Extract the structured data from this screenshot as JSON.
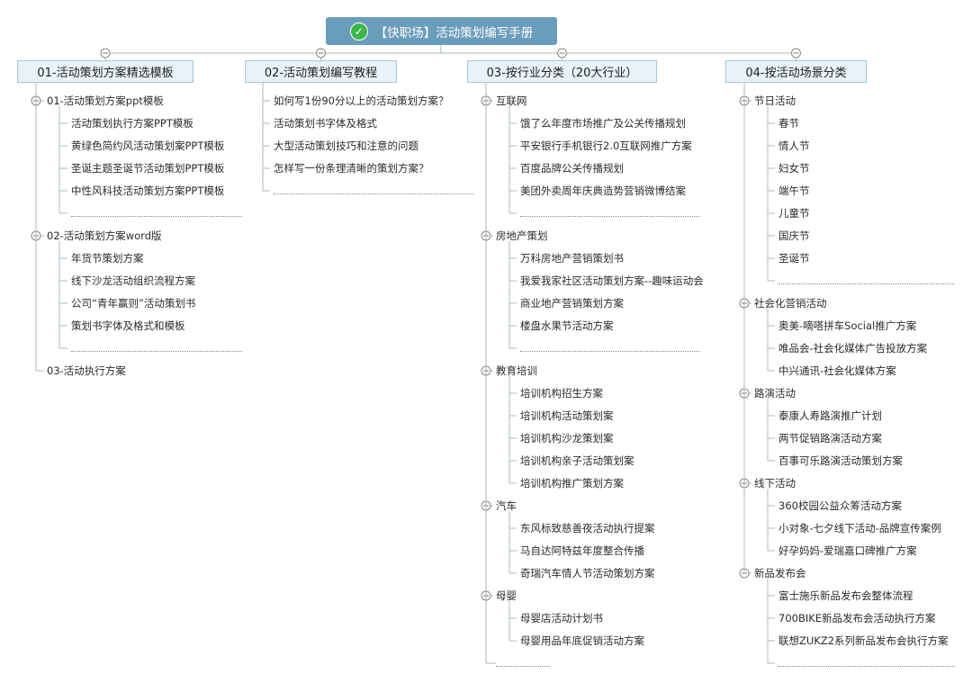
{
  "root": {
    "title": "【快职场】活动策划编写手册",
    "icon": "check-circle-icon"
  },
  "colors": {
    "root_bg": "#6a9dbb",
    "cat_bg": "#e9f2f8",
    "cat_border": "#a7c7dc",
    "line": "#aab8c2",
    "check": "#3cb64a"
  },
  "categories": [
    {
      "label": "01-活动策划方案精选模板",
      "groups": [
        {
          "label": "01-活动策划方案ppt模板",
          "items": [
            "活动策划执行方案PPT模板",
            "黄绿色简约风活动策划案PPT模板",
            "圣诞主题圣诞节活动策划PPT模板",
            "中性风科技活动策划方案PPT模板",
            "…………"
          ]
        },
        {
          "label": "02-活动策划方案word版",
          "items": [
            "年货节策划方案",
            "线下沙龙活动组织流程方案",
            "公司“青年赢则”活动策划书",
            "策划书字体及格式和模板",
            "…………"
          ]
        },
        {
          "label": "03-活动执行方案",
          "items": []
        }
      ]
    },
    {
      "label": "02-活动策划编写教程",
      "items": [
        "如何写1份90分以上的活动策划方案？",
        "活动策划书字体及格式",
        "大型活动策划技巧和注意的问题",
        "怎样写一份条理清晰的策划方案？",
        "…………"
      ]
    },
    {
      "label": "03-按行业分类（20大行业）",
      "groups": [
        {
          "label": "互联网",
          "items": [
            "饿了么年度市场推广及公关传播规划",
            "平安银行手机银行2.0互联网推广方案",
            "百度品牌公关传播规划",
            "美团外卖周年庆典造势营销微博结案",
            "…………"
          ]
        },
        {
          "label": "房地产策划",
          "items": [
            "万科房地产营销策划书",
            "我爱我家社区活动策划方案--趣味运动会",
            "商业地产营销策划方案",
            "楼盘水果节活动方案",
            "…………"
          ]
        },
        {
          "label": "教育培训",
          "items": [
            "培训机构招生方案",
            "培训机构活动策划案",
            "培训机构沙龙策划案",
            "培训机构亲子活动策划案",
            "培训机构推广策划方案"
          ]
        },
        {
          "label": "汽车",
          "items": [
            "东风标致慈善夜活动执行提案",
            "马自达阿特兹年度整合传播",
            "奇瑞汽车情人节活动策划方案"
          ]
        },
        {
          "label": "母婴",
          "items": [
            "母婴店活动计划书",
            "母婴用品年底促销活动方案"
          ]
        },
        {
          "label": "…………",
          "items": []
        }
      ]
    },
    {
      "label": "04-按活动场景分类",
      "groups": [
        {
          "label": "节日活动",
          "items": [
            "春节",
            "情人节",
            "妇女节",
            "端午节",
            "儿童节",
            "国庆节",
            "圣诞节",
            "…………"
          ]
        },
        {
          "label": "社会化营销活动",
          "items": [
            "奥美-嘀嗒拼车Social推广方案",
            "唯品会-社会化媒体广告投放方案",
            "中兴通讯-社会化媒体方案"
          ]
        },
        {
          "label": "路演活动",
          "items": [
            "泰康人寿路演推广计划",
            "两节促销路演活动方案",
            "百事可乐路演活动策划方案"
          ]
        },
        {
          "label": "线下活动",
          "items": [
            "360校园公益众筹活动方案",
            "小对象-七夕线下活动-品牌宣传案例",
            "好孕妈妈-爱瑞嘉口碑推广方案"
          ]
        },
        {
          "label": "新品发布会",
          "items": [
            "富士施乐新品发布会整体流程",
            "700BIKE新品发布会活动执行方案",
            "联想ZUKZ2系列新品发布会执行方案",
            "…………"
          ]
        }
      ]
    }
  ]
}
